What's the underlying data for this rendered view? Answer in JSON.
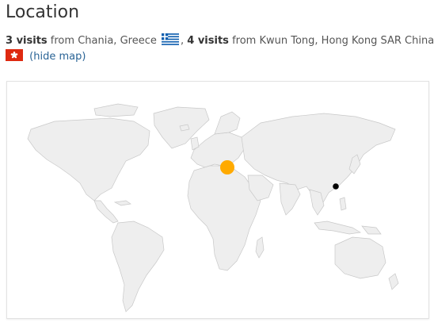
{
  "header": {
    "title": "Location"
  },
  "visits": [
    {
      "count_label": "3 visits",
      "from_label": "from",
      "place": "Chania, Greece",
      "flag": "greece-flag"
    },
    {
      "count_label": "4 visits",
      "from_label": "from",
      "place": "Kwun Tong, Hong Kong SAR China",
      "flag": "hong-kong-flag"
    }
  ],
  "separator": ",",
  "hide_map_label": "(hide map)",
  "map": {
    "markers": [
      {
        "place": "Chania, Greece",
        "visits": 3,
        "color": "#ffaa00"
      },
      {
        "place": "Kwun Tong, Hong Kong SAR China",
        "visits": 4,
        "color": "#000000"
      }
    ],
    "land_color": "#eeeeee",
    "border_color": "#c8c8c8"
  },
  "colors": {
    "link": "#2a6496",
    "text": "#333333"
  }
}
